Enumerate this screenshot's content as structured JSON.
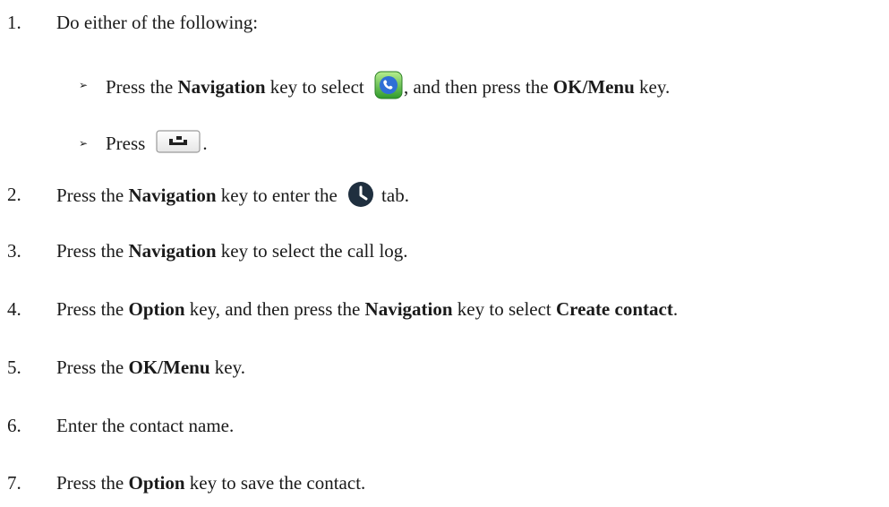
{
  "steps": [
    {
      "number": "1.",
      "parts": [
        "Do either of the following:"
      ]
    },
    {
      "number": "2.",
      "parts": [
        "Press the ",
        "Navigation",
        " key to enter the ",
        "tab."
      ]
    },
    {
      "number": "3.",
      "parts": [
        "Press the ",
        "Navigation",
        " key to select the call log."
      ]
    },
    {
      "number": "4.",
      "parts": [
        "Press the ",
        "Option",
        " key, and then press the ",
        "Navigation",
        " key to select ",
        "Create contact",
        "."
      ]
    },
    {
      "number": "5.",
      "parts": [
        "Press the ",
        "OK/Menu",
        " key."
      ]
    },
    {
      "number": "6.",
      "parts": [
        "Enter the contact name."
      ]
    },
    {
      "number": "7.",
      "parts": [
        "Press the ",
        "Option",
        " key to save the contact."
      ]
    }
  ],
  "sub_items": [
    {
      "bullet": "➢",
      "parts": [
        "Press the ",
        "Navigation",
        " key to select ",
        ", and then press the ",
        "OK/Menu",
        " key."
      ]
    },
    {
      "bullet": "➢",
      "parts": [
        "Press",
        "."
      ]
    }
  ],
  "icons": {
    "phone_app": "phone-app-icon",
    "redial_key": "redial-key-icon",
    "history": "history-clock-icon"
  },
  "colors": {
    "text": "#1a1a1a",
    "phone_icon_green_light": "#9be07a",
    "phone_icon_green_dark": "#2f9a2a",
    "phone_icon_blue": "#2f6fd6",
    "history_icon": "#1f2f3f",
    "key_border": "#9a9a9a"
  }
}
